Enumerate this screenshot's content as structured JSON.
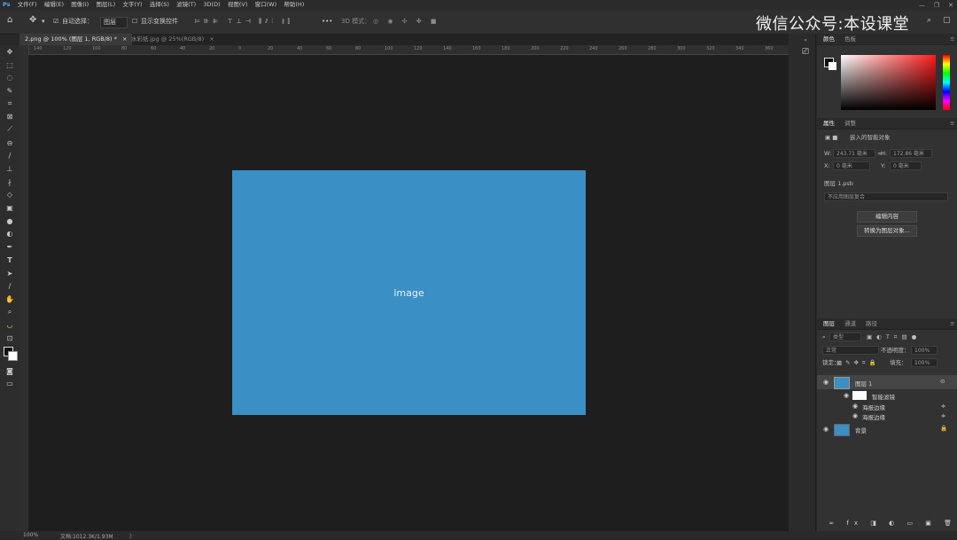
{
  "menubar": {
    "items": [
      "文件(F)",
      "编辑(E)",
      "图像(I)",
      "图层(L)",
      "文字(Y)",
      "选择(S)",
      "滤镜(T)",
      "3D(D)",
      "视图(V)",
      "窗口(W)",
      "帮助(H)"
    ],
    "window_controls": {
      "minimize": "—",
      "restore": "❐",
      "close": "✕"
    }
  },
  "options": {
    "auto_select_label": "自动选择：",
    "auto_select_value": "图层",
    "show_transform_label": "显示变换控件",
    "three_d_mode": "3D 模式：",
    "more": "•••"
  },
  "brand": {
    "text": "微信公众号:本设课堂"
  },
  "tabs": [
    {
      "label": "2.png @ 100% (图层 1, RGB/8) *",
      "close": "×"
    },
    {
      "label": "水彩纸.jpg @ 25%(RGB/8)",
      "close": "×"
    }
  ],
  "ruler_labels": [
    "140",
    "120",
    "100",
    "80",
    "60",
    "40",
    "20",
    "0",
    "20",
    "40",
    "60",
    "80",
    "100",
    "120",
    "140",
    "160",
    "180",
    "200",
    "220",
    "240",
    "260",
    "280",
    "300",
    "320",
    "340",
    "360"
  ],
  "status": {
    "zoom": "100%",
    "doc": "文档:1012.3K/1.93M",
    "arrow": "〉"
  },
  "color_panel": {
    "tabs": [
      "颜色",
      "色板"
    ],
    "colors": {
      "foreground": "#111111",
      "background": "#ffffff",
      "hue_accent": "#ff1a1a"
    }
  },
  "properties": {
    "tabs": [
      "属性",
      "调整"
    ],
    "type_label": "嵌入的智能对象",
    "w_label": "W:",
    "w_value": "243.71 毫米",
    "h_label": "H:",
    "h_value": "172.86 毫米",
    "x_label": "X:",
    "x_value": "0 毫米",
    "y_label": "Y:",
    "y_value": "0 毫米",
    "layer_label": "图层 1.psb",
    "comp_placeholder": "不应用图层复合",
    "edit_btn": "编辑内容",
    "convert_btn": "转换为图层对象..."
  },
  "layers_panel": {
    "tabs": [
      "图层",
      "通道",
      "路径"
    ],
    "filter_label": "类型",
    "blend_mode": "正常",
    "opacity_label": "不透明度：",
    "opacity_value": "100%",
    "lock_label": "锁定：",
    "fill_label": "填充：",
    "fill_value": "100%",
    "layers": [
      {
        "name": "图层 1",
        "type": "smart"
      },
      {
        "name": "智能滤镜",
        "type": "smart-filter"
      },
      {
        "name": "海报边缘",
        "type": "filter"
      },
      {
        "name": "海报边缘",
        "type": "filter"
      },
      {
        "name": "背景",
        "type": "background"
      }
    ]
  },
  "image": {
    "placeholder": "image"
  }
}
